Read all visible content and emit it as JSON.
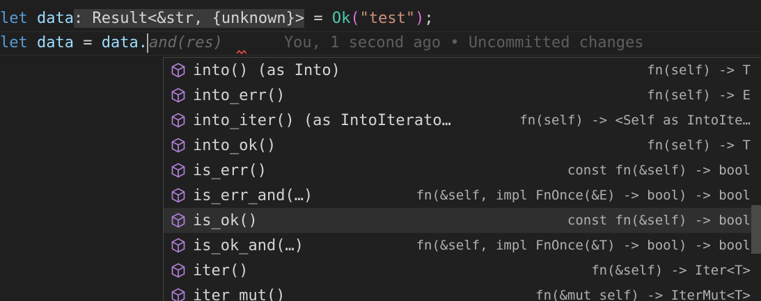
{
  "editor": {
    "line1": {
      "kw_let": "let",
      "var_data": "data",
      "type_hint": ": Result<&str, {unknown}>",
      "eq": " = ",
      "ok": "Ok",
      "paren_open": "(",
      "string": "\"test\"",
      "paren_close": ")",
      "semi": ";"
    },
    "line2": {
      "kw_let": "let",
      "var_data": "data",
      "eq": " = ",
      "expr": "data.",
      "ghost_text": "and(res)",
      "blame": "You, 1 second ago • Uncommitted changes"
    }
  },
  "suggestions": [
    {
      "label": "into() (as Into)",
      "detail": "fn(self) -> T",
      "icon": "method-cube-icon"
    },
    {
      "label": "into_err()",
      "detail": "fn(self) -> E",
      "icon": "method-cube-icon"
    },
    {
      "label": "into_iter() (as IntoIterato…",
      "detail": "fn(self) -> <Self as IntoIte…",
      "icon": "method-cube-icon"
    },
    {
      "label": "into_ok()",
      "detail": "fn(self) -> T",
      "icon": "method-cube-icon"
    },
    {
      "label": "is_err()",
      "detail": "const fn(&self) -> bool",
      "icon": "method-cube-icon"
    },
    {
      "label": "is_err_and(…)",
      "detail": "fn(&self, impl FnOnce(&E) -> bool) -> bool",
      "icon": "method-cube-icon"
    },
    {
      "label": "is_ok()",
      "detail": "const fn(&self) -> bool",
      "icon": "method-cube-icon",
      "selected": true
    },
    {
      "label": "is_ok_and(…)",
      "detail": "fn(&self, impl FnOnce(&T) -> bool) -> bool",
      "icon": "method-cube-icon"
    },
    {
      "label": "iter()",
      "detail": "fn(&self) -> Iter<T>",
      "icon": "method-cube-icon"
    },
    {
      "label": "iter_mut()",
      "detail": "fn(&mut self) -> IterMut<T>",
      "icon": "method-cube-icon"
    }
  ],
  "colors": {
    "icon": "#b180d7",
    "squiggle": "#f14c4c"
  }
}
